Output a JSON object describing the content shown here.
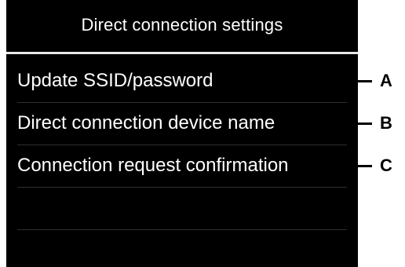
{
  "title": "Direct connection settings",
  "menu": {
    "items": [
      {
        "label": "Update SSID/password",
        "callout": "A"
      },
      {
        "label": "Direct connection device name",
        "callout": "B"
      },
      {
        "label": "Connection request confirmation",
        "callout": "C"
      }
    ]
  },
  "colors": {
    "screen_background": "#000000",
    "text": "#ffffff",
    "callout": "#000000"
  }
}
